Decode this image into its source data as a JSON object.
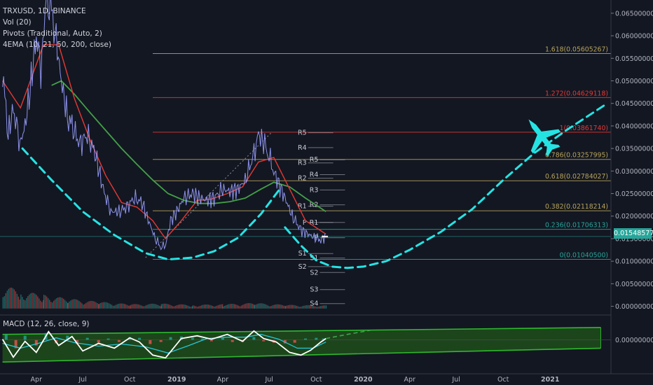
{
  "legend": {
    "symbol": "TRXUSD, 1D, BINANCE",
    "vol": "Vol (20)",
    "pivots": "Pivots (Traditional, Auto, 2)",
    "ema": "4EMA (10, 21, 50, 200, close)"
  },
  "macd_label": "MACD (12, 26, close, 9)",
  "last_price": "0.01548577",
  "colors": {
    "background": "#131722",
    "fib_red": "#e53935",
    "fib_olive": "#b8a45a",
    "fib_teal": "#26a69a",
    "cyan": "#26e3e3",
    "green": "#2eb82e",
    "ema_red": "#e53935",
    "ema_green": "#43a047",
    "price": "#9aa0ff"
  },
  "chart_data": [
    {
      "type": "line",
      "title": "TRXUSD, 1D, BINANCE",
      "y_ticks": [
        "0.06500000",
        "0.06000000",
        "0.05500000",
        "0.05000000",
        "0.04500000",
        "0.04000000",
        "0.03500000",
        "0.03000000",
        "0.02500000",
        "0.02000000",
        "0.01500000",
        "0.01000000",
        "0.00500000",
        "0.00000000"
      ],
      "y_tick_values": [
        0.065,
        0.06,
        0.055,
        0.05,
        0.045,
        0.04,
        0.035,
        0.03,
        0.025,
        0.02,
        0.015,
        0.01,
        0.005,
        0.0
      ],
      "ylim": [
        -0.001,
        0.067
      ],
      "x_ticks": [
        "Apr",
        "Jul",
        "Oct",
        "2019",
        "Apr",
        "Jul",
        "Oct",
        "2020",
        "Apr",
        "Jul",
        "Oct",
        "2021"
      ],
      "x_tick_dates": [
        "2018-04-01",
        "2018-07-01",
        "2018-10-01",
        "2019-01-01",
        "2019-04-01",
        "2019-07-01",
        "2019-10-01",
        "2020-01-01",
        "2020-04-01",
        "2020-07-01",
        "2020-10-01",
        "2021-01-01"
      ],
      "xlim": [
        "2018-01-20",
        "2021-04-30"
      ],
      "fib_levels": [
        {
          "label": "1.618(0.05605267)",
          "value": 0.05605267,
          "color": "olive"
        },
        {
          "label": "1.272(0.04629118)",
          "value": 0.04629118,
          "color": "red"
        },
        {
          "label": "1(0.03861740)",
          "value": 0.0386174,
          "color": "red"
        },
        {
          "label": "0.786(0.03257995)",
          "value": 0.03257995,
          "color": "olive"
        },
        {
          "label": "0.618(0.02784027)",
          "value": 0.02784027,
          "color": "olive"
        },
        {
          "label": "0.382(0.02118214)",
          "value": 0.02118214,
          "color": "olive"
        },
        {
          "label": "0.236(0.01706313)",
          "value": 0.01706313,
          "color": "teal"
        },
        {
          "label": "0(0.01040500)",
          "value": 0.010405,
          "color": "teal"
        }
      ],
      "pivots": [
        {
          "label": "R5",
          "value": 0.0385,
          "x": "2019-09-15"
        },
        {
          "label": "R4",
          "value": 0.0352,
          "x": "2019-09-15"
        },
        {
          "label": "R3",
          "value": 0.0318,
          "x": "2019-09-15"
        },
        {
          "label": "R2",
          "value": 0.0284,
          "x": "2019-09-15"
        },
        {
          "label": "R1",
          "value": 0.0222,
          "x": "2019-09-15"
        },
        {
          "label": "P",
          "value": 0.0186,
          "x": "2019-09-15"
        },
        {
          "label": "S1",
          "value": 0.0117,
          "x": "2019-09-15"
        },
        {
          "label": "S2",
          "value": 0.0088,
          "x": "2019-09-15"
        },
        {
          "label": "R5",
          "value": 0.0325,
          "x": "2019-10-08"
        },
        {
          "label": "R4",
          "value": 0.0292,
          "x": "2019-10-08"
        },
        {
          "label": "R3",
          "value": 0.0258,
          "x": "2019-10-08"
        },
        {
          "label": "R2",
          "value": 0.0225,
          "x": "2019-10-08"
        },
        {
          "label": "R1",
          "value": 0.0186,
          "x": "2019-10-08"
        },
        {
          "label": "P",
          "value": 0.0152,
          "x": "2019-10-08"
        },
        {
          "label": "S1",
          "value": 0.0107,
          "x": "2019-10-08"
        },
        {
          "label": "S2",
          "value": 0.0075,
          "x": "2019-10-08"
        },
        {
          "label": "S3",
          "value": 0.0037,
          "x": "2019-10-08"
        },
        {
          "label": "S4",
          "value": 0.0006,
          "x": "2019-10-08"
        }
      ],
      "price": {
        "dates": [
          "2018-01-25",
          "2018-02-05",
          "2018-02-15",
          "2018-02-28",
          "2018-03-10",
          "2018-03-20",
          "2018-04-01",
          "2018-04-10",
          "2018-04-20",
          "2018-05-01",
          "2018-05-10",
          "2018-05-20",
          "2018-06-01",
          "2018-06-10",
          "2018-06-25",
          "2018-07-10",
          "2018-07-25",
          "2018-08-10",
          "2018-08-25",
          "2018-09-10",
          "2018-09-25",
          "2018-10-10",
          "2018-10-25",
          "2018-11-10",
          "2018-11-20",
          "2018-12-01",
          "2018-12-10",
          "2018-12-20",
          "2019-01-01",
          "2019-01-15",
          "2019-02-01",
          "2019-02-15",
          "2019-03-01",
          "2019-03-15",
          "2019-04-01",
          "2019-04-15",
          "2019-05-01",
          "2019-05-15",
          "2019-05-30",
          "2019-06-10",
          "2019-06-20",
          "2019-07-01",
          "2019-07-10",
          "2019-07-20",
          "2019-08-01",
          "2019-08-15",
          "2019-09-01",
          "2019-09-15",
          "2019-10-01",
          "2019-10-10",
          "2019-10-20"
        ],
        "values": [
          0.052,
          0.038,
          0.044,
          0.036,
          0.04,
          0.048,
          0.06,
          0.052,
          0.068,
          0.066,
          0.059,
          0.05,
          0.042,
          0.04,
          0.036,
          0.038,
          0.034,
          0.026,
          0.021,
          0.021,
          0.022,
          0.024,
          0.023,
          0.018,
          0.015,
          0.013,
          0.0135,
          0.019,
          0.021,
          0.024,
          0.025,
          0.024,
          0.0235,
          0.024,
          0.026,
          0.0255,
          0.026,
          0.028,
          0.033,
          0.038,
          0.0365,
          0.033,
          0.03,
          0.027,
          0.024,
          0.02,
          0.017,
          0.016,
          0.015,
          0.0148,
          0.01548577
        ]
      },
      "ema_fast": {
        "dates": [
          "2018-01-25",
          "2018-03-01",
          "2018-04-15",
          "2018-05-15",
          "2018-06-15",
          "2018-07-15",
          "2018-08-15",
          "2018-09-15",
          "2018-10-15",
          "2018-11-15",
          "2018-12-10",
          "2019-01-10",
          "2019-02-10",
          "2019-03-10",
          "2019-04-10",
          "2019-05-10",
          "2019-06-10",
          "2019-07-10",
          "2019-08-10",
          "2019-09-10",
          "2019-10-20"
        ],
        "values": [
          0.05,
          0.044,
          0.058,
          0.058,
          0.046,
          0.037,
          0.029,
          0.023,
          0.022,
          0.019,
          0.015,
          0.019,
          0.0235,
          0.0238,
          0.025,
          0.0265,
          0.032,
          0.033,
          0.026,
          0.019,
          0.016
        ]
      },
      "ema_slow": {
        "dates": [
          "2018-05-01",
          "2018-05-20",
          "2018-06-15",
          "2018-07-15",
          "2018-08-15",
          "2018-09-15",
          "2018-10-15",
          "2018-11-15",
          "2018-12-15",
          "2019-01-15",
          "2019-02-15",
          "2019-03-15",
          "2019-04-15",
          "2019-05-15",
          "2019-06-15",
          "2019-07-10",
          "2019-08-10",
          "2019-09-10",
          "2019-10-20"
        ],
        "values": [
          0.049,
          0.05,
          0.047,
          0.043,
          0.039,
          0.035,
          0.0315,
          0.028,
          0.025,
          0.0235,
          0.0228,
          0.0228,
          0.0232,
          0.024,
          0.026,
          0.0275,
          0.0265,
          0.024,
          0.021
        ]
      },
      "volume": {
        "dates": [
          "2018-01-25",
          "2018-03-01",
          "2018-04-15",
          "2018-06-01",
          "2018-08-01",
          "2018-10-01",
          "2018-12-01",
          "2019-02-01",
          "2019-04-01",
          "2019-06-01",
          "2019-08-01",
          "2019-10-20"
        ],
        "values": [
          0.0038,
          0.0028,
          0.0022,
          0.0016,
          0.0011,
          0.0007,
          0.0008,
          0.0006,
          0.0007,
          0.0009,
          0.0006,
          0.0005
        ]
      },
      "cup_left": {
        "dates": [
          "2018-03-05",
          "2018-05-01",
          "2018-07-01",
          "2018-09-01",
          "2018-11-01",
          "2018-12-15",
          "2019-02-01",
          "2019-03-15",
          "2019-05-01",
          "2019-06-15",
          "2019-07-25"
        ],
        "values": [
          0.035,
          0.028,
          0.021,
          0.0158,
          0.0118,
          0.0104,
          0.0108,
          0.0122,
          0.0152,
          0.0205,
          0.0265
        ]
      },
      "cup_right": {
        "dates": [
          "2019-08-01",
          "2019-09-01",
          "2019-10-01",
          "2019-11-01",
          "2019-12-01",
          "2020-01-01",
          "2020-02-15",
          "2020-04-01",
          "2020-06-01",
          "2020-08-01",
          "2020-10-01",
          "2020-12-01",
          "2021-02-01",
          "2021-04-20"
        ],
        "values": [
          0.0175,
          0.0135,
          0.0102,
          0.0088,
          0.0085,
          0.0088,
          0.01,
          0.0125,
          0.0165,
          0.0215,
          0.028,
          0.034,
          0.039,
          0.0448
        ]
      },
      "rising_trendline": {
        "dates": [
          "2018-11-01",
          "2019-07-05"
        ],
        "values": [
          0.0108,
          0.0385
        ]
      },
      "jet_position": {
        "date": "2020-12-15",
        "value": 0.0378
      }
    },
    {
      "type": "line",
      "title": "MACD (12, 26, close, 9)",
      "y_ticks": [
        "0.00000000"
      ],
      "channel": {
        "upper": {
          "dates": [
            "2018-01-25",
            "2021-04-10"
          ],
          "values": [
            0.0008,
            0.0018
          ]
        },
        "lower": {
          "dates": [
            "2018-01-25",
            "2021-04-10"
          ],
          "values": [
            -0.0032,
            -0.0012
          ]
        },
        "fill_end_date": "2021-04-10"
      },
      "macd": {
        "dates": [
          "2018-01-25",
          "2018-02-15",
          "2018-03-10",
          "2018-04-01",
          "2018-04-25",
          "2018-05-15",
          "2018-06-10",
          "2018-07-01",
          "2018-08-01",
          "2018-09-01",
          "2018-10-01",
          "2018-10-20",
          "2018-11-15",
          "2018-12-10",
          "2019-01-10",
          "2019-02-10",
          "2019-03-10",
          "2019-04-10",
          "2019-05-10",
          "2019-06-01",
          "2019-06-20",
          "2019-07-15",
          "2019-08-10",
          "2019-09-01",
          "2019-09-20",
          "2019-10-10",
          "2019-10-20"
        ],
        "values": [
          0.0001,
          -0.0025,
          -0.0002,
          -0.0018,
          0.0012,
          -0.0008,
          0.0005,
          -0.0016,
          -0.0005,
          -0.0012,
          0.0003,
          -0.0003,
          -0.0022,
          -0.0026,
          0.0002,
          0.0006,
          0.0001,
          0.0008,
          -0.0002,
          0.0013,
          0.0002,
          -0.0003,
          -0.0018,
          -0.0022,
          -0.0015,
          -0.0003,
          0.0002
        ]
      },
      "signal": {
        "dates": [
          "2018-01-25",
          "2018-03-01",
          "2018-04-10",
          "2018-05-10",
          "2018-06-15",
          "2018-08-01",
          "2018-09-15",
          "2018-11-01",
          "2018-12-15",
          "2019-01-25",
          "2019-03-01",
          "2019-04-10",
          "2019-05-15",
          "2019-06-15",
          "2019-07-20",
          "2019-08-25",
          "2019-09-25",
          "2019-10-20"
        ],
        "values": [
          -0.0005,
          -0.0012,
          -0.0004,
          0.0003,
          -0.0004,
          -0.0009,
          -0.0006,
          -0.001,
          -0.0019,
          -0.0008,
          0.0002,
          0.0004,
          0.0004,
          0.0008,
          0.0001,
          -0.0012,
          -0.0012,
          -0.0003
        ]
      },
      "projection": {
        "dates": [
          "2019-10-20",
          "2019-12-01",
          "2020-01-15"
        ],
        "values": [
          0.0002,
          0.0008,
          0.0014
        ]
      },
      "histogram": {
        "dates": [
          "2018-02-01",
          "2018-02-20",
          "2018-03-10",
          "2018-04-01",
          "2018-04-20",
          "2018-05-10",
          "2018-06-01",
          "2018-06-20",
          "2018-07-10",
          "2018-08-01",
          "2018-08-20",
          "2018-09-10",
          "2018-10-01",
          "2018-10-20",
          "2018-11-10",
          "2018-12-01",
          "2018-12-20",
          "2019-01-10",
          "2019-02-01",
          "2019-02-20",
          "2019-03-10",
          "2019-04-01",
          "2019-04-20",
          "2019-05-10",
          "2019-06-01",
          "2019-06-20",
          "2019-07-10",
          "2019-08-01",
          "2019-08-20",
          "2019-09-10",
          "2019-10-01",
          "2019-10-15"
        ],
        "values": [
          0.0008,
          -0.0012,
          0.0006,
          -0.0008,
          0.001,
          -0.0005,
          0.0006,
          -0.0006,
          0.0003,
          -0.0004,
          0.0002,
          -0.0003,
          0.0004,
          0.0003,
          -0.0006,
          -0.0003,
          0.0004,
          0.0005,
          0.0003,
          0.0002,
          -0.0002,
          0.0003,
          -0.0003,
          -0.0003,
          0.0004,
          -0.0002,
          -0.0004,
          -0.0005,
          -0.0004,
          0.0002,
          0.0003,
          0.0002
        ]
      }
    }
  ]
}
